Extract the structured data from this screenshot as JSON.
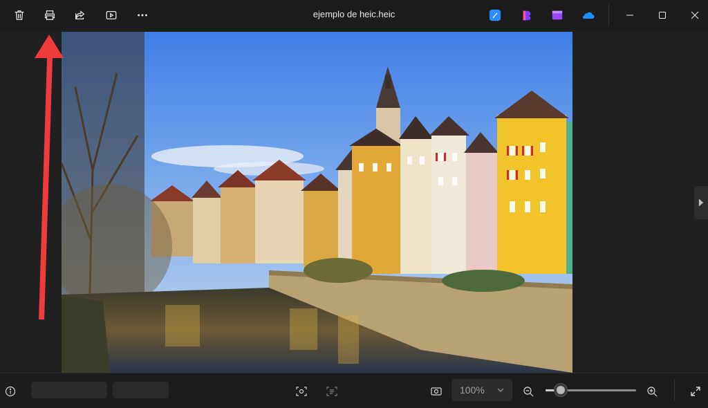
{
  "window": {
    "title": "ejemplo de heic.heic"
  },
  "toolbar": {
    "items": [
      {
        "name": "delete",
        "icon": "trash-icon"
      },
      {
        "name": "print",
        "icon": "printer-icon"
      },
      {
        "name": "share",
        "icon": "share-icon"
      },
      {
        "name": "slideshow",
        "icon": "play-icon"
      },
      {
        "name": "more",
        "icon": "more-icon"
      }
    ],
    "apps": [
      {
        "name": "Designer",
        "color": "#3aa0ff"
      },
      {
        "name": "Clipchamp",
        "color": "#7b3cff"
      },
      {
        "name": "Clipchamp Video",
        "color": "#a046ff"
      },
      {
        "name": "OneDrive",
        "color": "#1e90ff"
      }
    ]
  },
  "viewer": {
    "image_alt": "Colorful riverside houses with a church tower along a river",
    "annotation_color": "#ef3b3b"
  },
  "bottombar": {
    "info_icon": "info-icon",
    "zoom": {
      "value": "100%",
      "slider_fraction": 0.1
    }
  }
}
